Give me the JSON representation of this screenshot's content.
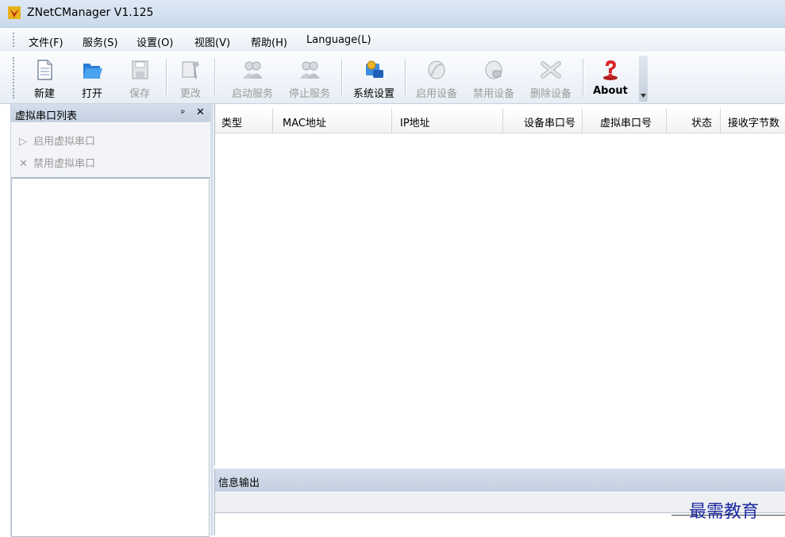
{
  "window": {
    "title": "ZNetCManager V1.125"
  },
  "menu": [
    {
      "label": "文件(F)"
    },
    {
      "label": "服务(S)"
    },
    {
      "label": "设置(O)"
    },
    {
      "label": "视图(V)"
    },
    {
      "label": "帮助(H)"
    },
    {
      "label": "Language(L)"
    }
  ],
  "toolbar": [
    {
      "label": "新建",
      "icon": "new-file-icon",
      "enabled": true
    },
    {
      "label": "打开",
      "icon": "open-folder-icon",
      "enabled": true
    },
    {
      "label": "保存",
      "icon": "save-icon",
      "enabled": false
    },
    {
      "label": "更改",
      "icon": "edit-icon",
      "enabled": false
    },
    {
      "label": "启动服务",
      "icon": "start-service-icon",
      "enabled": false
    },
    {
      "label": "停止服务",
      "icon": "stop-service-icon",
      "enabled": false
    },
    {
      "label": "系统设置",
      "icon": "system-settings-icon",
      "enabled": true
    },
    {
      "label": "启用设备",
      "icon": "enable-device-icon",
      "enabled": false
    },
    {
      "label": "禁用设备",
      "icon": "disable-device-icon",
      "enabled": false
    },
    {
      "label": "删除设备",
      "icon": "delete-device-icon",
      "enabled": false
    },
    {
      "label": "About",
      "icon": "help-about-icon",
      "enabled": true
    }
  ],
  "left_panel": {
    "title": "虚拟串口列表",
    "pin_glyph": "ᵖ",
    "close_glyph": "✕",
    "actions": [
      {
        "label": "启用虚拟串口",
        "glyph": "▷",
        "icon": "play-icon"
      },
      {
        "label": "禁用虚拟串口",
        "glyph": "✕",
        "icon": "x-icon"
      }
    ]
  },
  "grid": {
    "columns": [
      "类型",
      "MAC地址",
      "IP地址",
      "设备串口号",
      "虚拟串口号",
      "状态",
      "接收字节数"
    ]
  },
  "output_panel": {
    "title": "信息输出"
  },
  "watermark": {
    "text": "最需教育"
  },
  "colors": {
    "accent_blue": "#1b6fd1",
    "disabled_gray": "#9a9a9a",
    "panel_header": "#c3d0e0"
  }
}
